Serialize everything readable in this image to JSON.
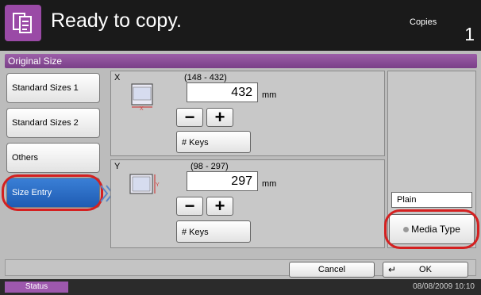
{
  "header": {
    "title": "Ready to copy.",
    "copies_label": "Copies",
    "copies_value": "1",
    "icon": "copy-icon"
  },
  "panel": {
    "title": "Original Size"
  },
  "sidebar": {
    "items": [
      {
        "label": "Standard Sizes 1"
      },
      {
        "label": "Standard Sizes 2"
      },
      {
        "label": "Others"
      },
      {
        "label": "Size Entry",
        "selected": true
      }
    ]
  },
  "x_section": {
    "axis": "X",
    "range": "(148 - 432)",
    "value": "432",
    "unit": "mm",
    "keys_label": "# Keys"
  },
  "y_section": {
    "axis": "Y",
    "range": "(98 - 297)",
    "value": "297",
    "unit": "mm",
    "keys_label": "# Keys"
  },
  "stepper": {
    "minus": "−",
    "plus": "+"
  },
  "media": {
    "current": "Plain",
    "button_label": "Media Type"
  },
  "footer": {
    "cancel_label": "Cancel",
    "ok_label": "OK"
  },
  "status": {
    "label": "Status",
    "datetime": "08/08/2009   10:10"
  },
  "colors": {
    "accent": "#9a4aa6",
    "selected": "#2a6cc8",
    "highlight": "#d42020"
  }
}
